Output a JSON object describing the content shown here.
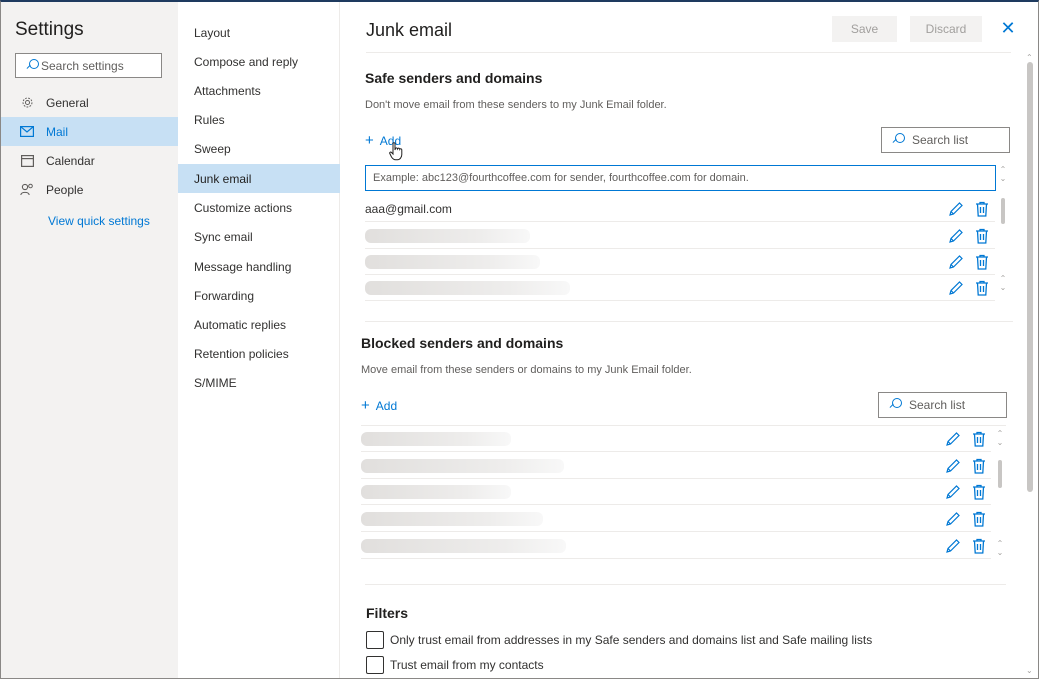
{
  "settings": {
    "title": "Settings",
    "search_placeholder": "Search settings",
    "nav": [
      {
        "label": "General",
        "icon": "gear-icon"
      },
      {
        "label": "Mail",
        "icon": "mail-icon"
      },
      {
        "label": "Calendar",
        "icon": "calendar-icon"
      },
      {
        "label": "People",
        "icon": "people-icon"
      }
    ],
    "active_nav": "Mail",
    "quick_settings_link": "View quick settings"
  },
  "subnav": {
    "items": [
      "Layout",
      "Compose and reply",
      "Attachments",
      "Rules",
      "Sweep",
      "Junk email",
      "Customize actions",
      "Sync email",
      "Message handling",
      "Forwarding",
      "Automatic replies",
      "Retention policies",
      "S/MIME"
    ],
    "active": "Junk email"
  },
  "content": {
    "title": "Junk email",
    "save_label": "Save",
    "discard_label": "Discard",
    "close_icon": "close-icon",
    "safe": {
      "heading": "Safe senders and domains",
      "description": "Don't move email from these senders to my Junk Email folder.",
      "add_label": "Add",
      "search_label": "Search list",
      "input_placeholder": "Example: abc123@fourthcoffee.com for sender, fourthcoffee.com for domain.",
      "entries": [
        "aaa@gmail.com",
        "",
        "",
        ""
      ]
    },
    "blocked": {
      "heading": "Blocked senders and domains",
      "description": "Move email from these senders or domains to my Junk Email folder.",
      "add_label": "Add",
      "search_label": "Search list",
      "entries": [
        "",
        "",
        "",
        "",
        ""
      ]
    },
    "filters": {
      "heading": "Filters",
      "options": [
        {
          "label": "Only trust email from addresses in my Safe senders and domains list and Safe mailing lists",
          "checked": false
        },
        {
          "label": "Trust email from my contacts",
          "checked": false
        }
      ]
    }
  },
  "colors": {
    "accent": "#0078d4",
    "active_bg": "#c7e0f4",
    "pane_bg": "#f3f2f1"
  }
}
